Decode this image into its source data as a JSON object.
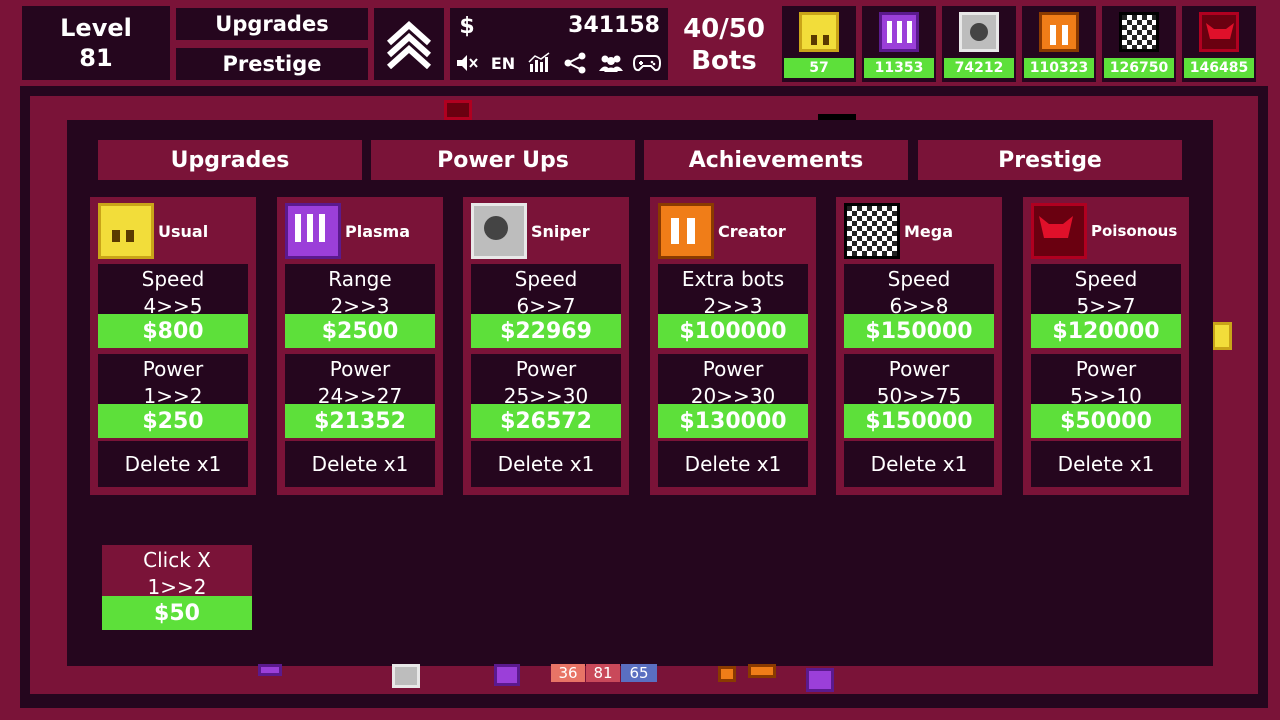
{
  "header": {
    "level_label": "Level",
    "level_value": "81",
    "upgrades_button": "Upgrades",
    "prestige_button": "Prestige",
    "rank_icon": "chevron-up-icon",
    "currency_symbol": "$",
    "money": "341158",
    "lang": "EN",
    "bots_count": "40/50",
    "bots_label": "Bots"
  },
  "bot_counts": [
    {
      "type": "usual",
      "count": "57"
    },
    {
      "type": "plasma",
      "count": "11353"
    },
    {
      "type": "sniper",
      "count": "74212"
    },
    {
      "type": "creator",
      "count": "110323"
    },
    {
      "type": "mega",
      "count": "126750"
    },
    {
      "type": "poisonous",
      "count": "146485"
    }
  ],
  "tabs": [
    "Upgrades",
    "Power Ups",
    "Achievements",
    "Prestige"
  ],
  "cards": [
    {
      "name": "Usual",
      "u1": {
        "name": "Speed",
        "val": "4>>5",
        "price": "$800"
      },
      "u2": {
        "name": "Power",
        "val": "1>>2",
        "price": "$250"
      },
      "delete": "Delete x1"
    },
    {
      "name": "Plasma",
      "u1": {
        "name": "Range",
        "val": "2>>3",
        "price": "$2500"
      },
      "u2": {
        "name": "Power",
        "val": "24>>27",
        "price": "$21352"
      },
      "delete": "Delete x1"
    },
    {
      "name": "Sniper",
      "u1": {
        "name": "Speed",
        "val": "6>>7",
        "price": "$22969"
      },
      "u2": {
        "name": "Power",
        "val": "25>>30",
        "price": "$26572"
      },
      "delete": "Delete x1"
    },
    {
      "name": "Creator",
      "u1": {
        "name": "Extra bots",
        "val": "2>>3",
        "price": "$100000"
      },
      "u2": {
        "name": "Power",
        "val": "20>>30",
        "price": "$130000"
      },
      "delete": "Delete x1"
    },
    {
      "name": "Mega",
      "u1": {
        "name": "Speed",
        "val": "6>>8",
        "price": "$150000"
      },
      "u2": {
        "name": "Power",
        "val": "50>>75",
        "price": "$150000"
      },
      "delete": "Delete x1"
    },
    {
      "name": "Poisonous",
      "u1": {
        "name": "Speed",
        "val": "5>>7",
        "price": "$120000"
      },
      "u2": {
        "name": "Power",
        "val": "5>>10",
        "price": "$50000"
      },
      "delete": "Delete x1"
    }
  ],
  "click_upgrade": {
    "name": "Click X",
    "val": "1>>2",
    "price": "$50"
  },
  "field_blocks": [
    "36",
    "81",
    "65"
  ]
}
